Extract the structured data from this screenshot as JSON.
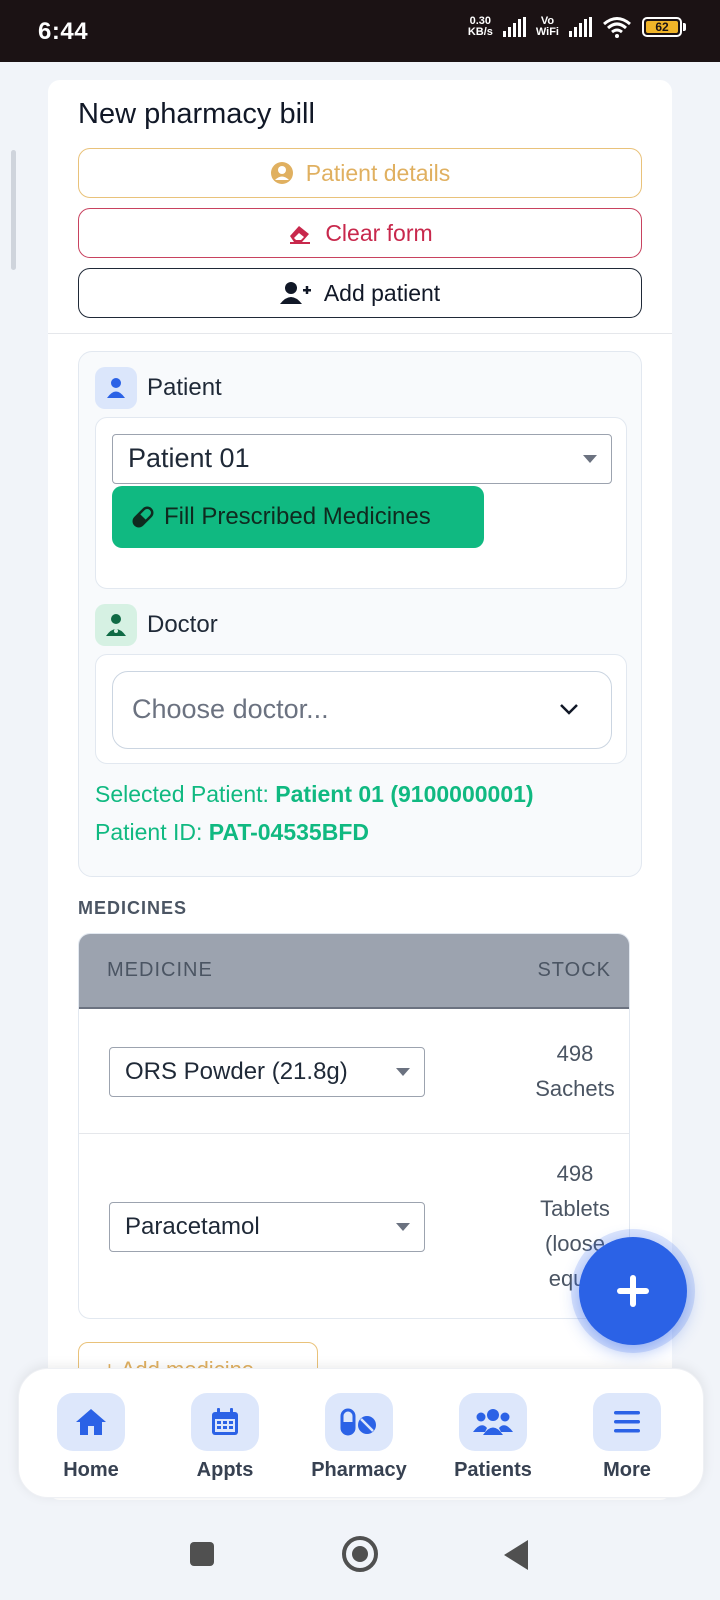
{
  "status_bar": {
    "time": "6:44",
    "net_speed_value": "0.30",
    "net_speed_unit": "KB/s",
    "vo_label": "Vo",
    "wifi_label": "WiFi",
    "battery": "62"
  },
  "header": {
    "title": "New pharmacy bill",
    "patient_details_label": "Patient details",
    "clear_form_label": "Clear form",
    "add_patient_label": "Add patient"
  },
  "patient": {
    "label": "Patient",
    "selected": "Patient 01",
    "fill_button_label": "Fill Prescribed Medicines"
  },
  "doctor": {
    "label": "Doctor",
    "placeholder": "Choose doctor..."
  },
  "selection_info": {
    "patient_prefix": "Selected Patient: ",
    "patient_value": "Patient 01 (9100000001)",
    "id_prefix": "Patient ID: ",
    "id_value": "PAT-04535BFD"
  },
  "medicines": {
    "heading": "MEDICINES",
    "col_medicine": "MEDICINE",
    "col_stock": "STOCK",
    "rows": [
      {
        "medicine": "ORS Powder (21.8g)",
        "stock_qty": "498",
        "stock_unit": "Sachets"
      },
      {
        "medicine": "Paracetamol",
        "stock_qty": "498",
        "stock_unit_line1": "Tablets",
        "stock_unit_line2": "(loose",
        "stock_unit_line3": "equiv"
      }
    ],
    "add_button_label": "+ Add medicine"
  },
  "bottom_nav": [
    {
      "label": "Home"
    },
    {
      "label": "Appts"
    },
    {
      "label": "Pharmacy"
    },
    {
      "label": "Patients"
    },
    {
      "label": "More"
    }
  ],
  "colors": {
    "accent_blue": "#2b62e6",
    "success_green": "#10b981",
    "warning_amber": "#e0b060",
    "danger_red": "#c8284c"
  }
}
